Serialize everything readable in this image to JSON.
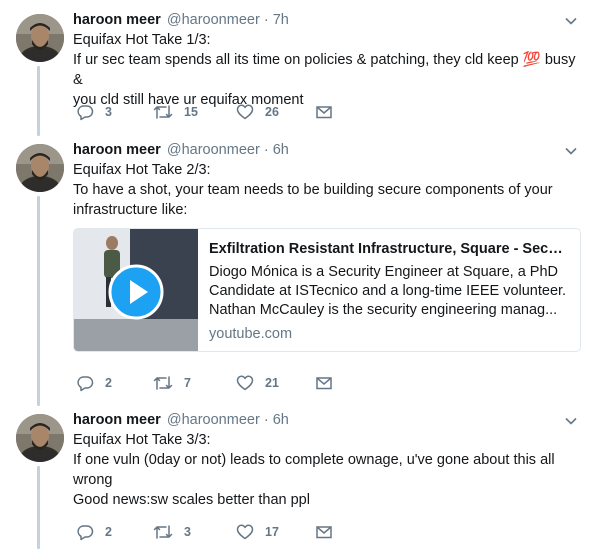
{
  "tweets": [
    {
      "name": "haroon meer",
      "handle": "@haroonmeer",
      "dot": "·",
      "time": "7h",
      "lines": [
        "Equifax Hot Take 1/3:",
        "If ur sec team spends all its time on policies & patching, they cld keep",
        "you cld still have ur equifax moment"
      ],
      "emoji": "💯",
      "emoji_tail": " busy &",
      "replies": "3",
      "retweets": "15",
      "likes": "26"
    },
    {
      "name": "haroon meer",
      "handle": "@haroonmeer",
      "dot": "·",
      "time": "6h",
      "lines": [
        "Equifax Hot Take 2/3:",
        "To have a shot, your team needs to be building secure components of your",
        "infrastructure like:"
      ],
      "card": {
        "title": "Exfiltration Resistant Infrastructure, Square - Securi...",
        "desc": [
          "Diogo Mónica is a Security Engineer at Square, a PhD",
          "Candidate at ISTecnico and a long-time IEEE volunteer.",
          "Nathan McCauley is the security engineering manag..."
        ],
        "domain": "youtube.com"
      },
      "replies": "2",
      "retweets": "7",
      "likes": "21"
    },
    {
      "name": "haroon meer",
      "handle": "@haroonmeer",
      "dot": "·",
      "time": "6h",
      "lines": [
        "Equifax Hot Take 3/3:",
        "If one vuln (0day or not) leads to complete ownage, u've gone about this all",
        "wrong",
        "Good news:sw scales better than ppl"
      ],
      "replies": "2",
      "retweets": "3",
      "likes": "17"
    }
  ],
  "colors": {
    "thread_line": "#c4d2df",
    "muted": "#657786",
    "text": "#14171a",
    "border": "#e1e8ed"
  },
  "icons": [
    "chevron-down-icon",
    "reply-icon",
    "retweet-icon",
    "like-icon",
    "direct-message-icon",
    "play-icon"
  ]
}
